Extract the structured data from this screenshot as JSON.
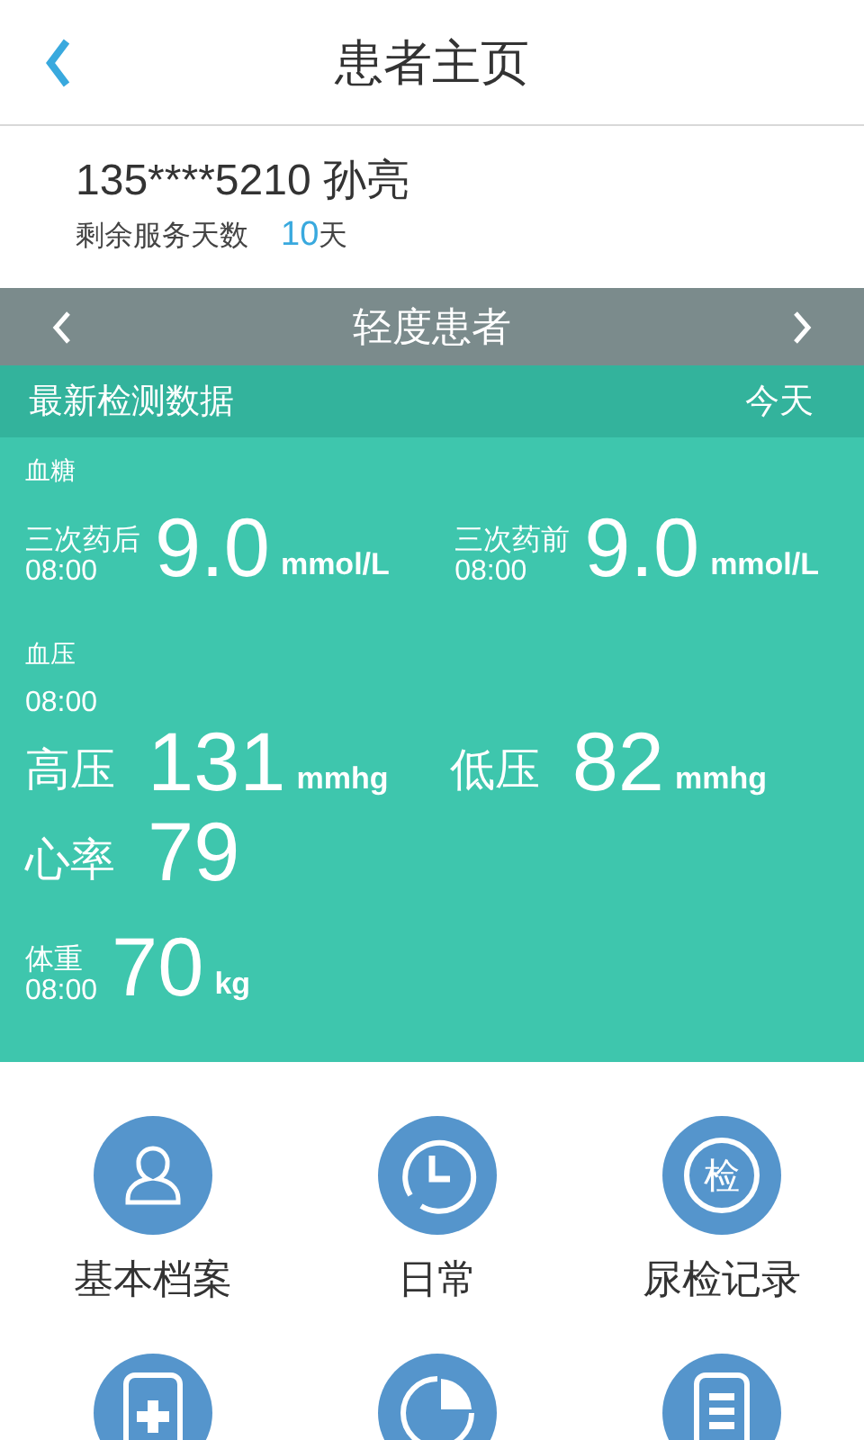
{
  "header": {
    "title": "患者主页"
  },
  "patient": {
    "phone": "135****5210",
    "name": "孙亮",
    "days_label": "剩余服务天数",
    "days_value": "10",
    "days_unit": "天"
  },
  "level_bar": {
    "label": "轻度患者"
  },
  "data_header": {
    "title": "最新检测数据",
    "date": "今天"
  },
  "blood_sugar": {
    "title": "血糖",
    "readings": [
      {
        "label": "三次药后",
        "time": "08:00",
        "value": "9.0",
        "unit": "mmol/L"
      },
      {
        "label": "三次药前",
        "time": "08:00",
        "value": "9.0",
        "unit": "mmol/L"
      }
    ]
  },
  "blood_pressure": {
    "title": "血压",
    "time": "08:00",
    "readings": [
      {
        "label": "高压",
        "value": "131",
        "unit": "mmhg"
      },
      {
        "label": "低压",
        "value": "82",
        "unit": "mmhg"
      }
    ],
    "heart_rate": {
      "label": "心率",
      "value": "79"
    }
  },
  "weight": {
    "title": "体重",
    "time": "08:00",
    "value": "70",
    "unit": "kg"
  },
  "menu": [
    {
      "kind": "person",
      "label": "基本档案"
    },
    {
      "kind": "clock",
      "label": "日常"
    },
    {
      "kind": "glyph",
      "glyph": "检",
      "label": "尿检记录"
    },
    {
      "kind": "medkit"
    },
    {
      "kind": "pie"
    },
    {
      "kind": "list"
    }
  ]
}
